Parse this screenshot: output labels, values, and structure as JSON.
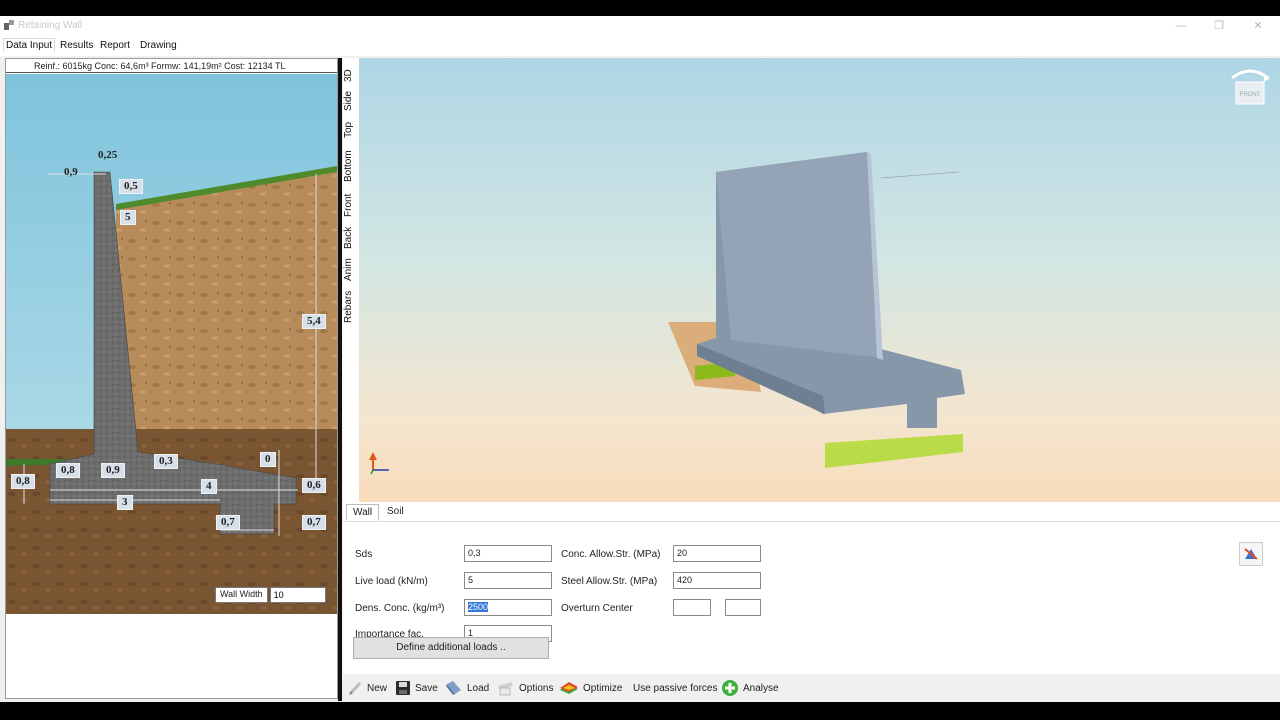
{
  "window": {
    "title": "Retaining Wall"
  },
  "menu": [
    "Data Input",
    "Results",
    "Report",
    "Drawing"
  ],
  "summary": "Reinf.: 6015kg  Conc: 64,6m³  Formw: 141,19m²  Cost: 12134 TL",
  "dims": {
    "top_width": "0,25",
    "front_batter": "0,9",
    "back_offset": "0,5",
    "slope_label": "5",
    "stem_height": "5,4",
    "toe_thickness": "0,8",
    "toe_length": "0,8",
    "stem_base": "0,9",
    "heel_haunch": "0,3",
    "key_offset": "0",
    "base_length": "4",
    "toe_heel": "3",
    "heel_thickness": "0,6",
    "key_width": "0,7",
    "key_depth": "0,7"
  },
  "wall_width": {
    "label": "Wall Width",
    "value": "10"
  },
  "view_tabs": [
    "3D",
    "Side",
    "Top",
    "Bottom",
    "Front",
    "Back",
    "Anim",
    "Rebars"
  ],
  "cube_label": "FRONT",
  "prop_tabs": [
    "Wall",
    "Soil"
  ],
  "fields": {
    "sds": {
      "label": "Sds",
      "value": "0,3"
    },
    "live_load": {
      "label": "Live load (kN/m)",
      "value": "5"
    },
    "dens_conc": {
      "label": "Dens. Conc. (kg/m³)",
      "value": "2500"
    },
    "importance": {
      "label": "Importance fac.",
      "value": "1"
    },
    "conc_allow": {
      "label": "Conc. Allow.Str. (MPa)",
      "value": "20"
    },
    "steel_allow": {
      "label": "Steel Allow.Str. (MPa)",
      "value": "420"
    },
    "overturn": {
      "label": "Overturn Center",
      "value1": "",
      "value2": ""
    }
  },
  "define_loads": "Define additional loads ..",
  "toolbar": {
    "new": "New",
    "save": "Save",
    "load": "Load",
    "options": "Options",
    "optimize": "Optimize",
    "passive": "Use passive forces",
    "analyse": "Analyse"
  },
  "colors": {
    "accent": "#3478d6",
    "concrete": "#8a99aa",
    "load_green": "#a8d43a"
  }
}
